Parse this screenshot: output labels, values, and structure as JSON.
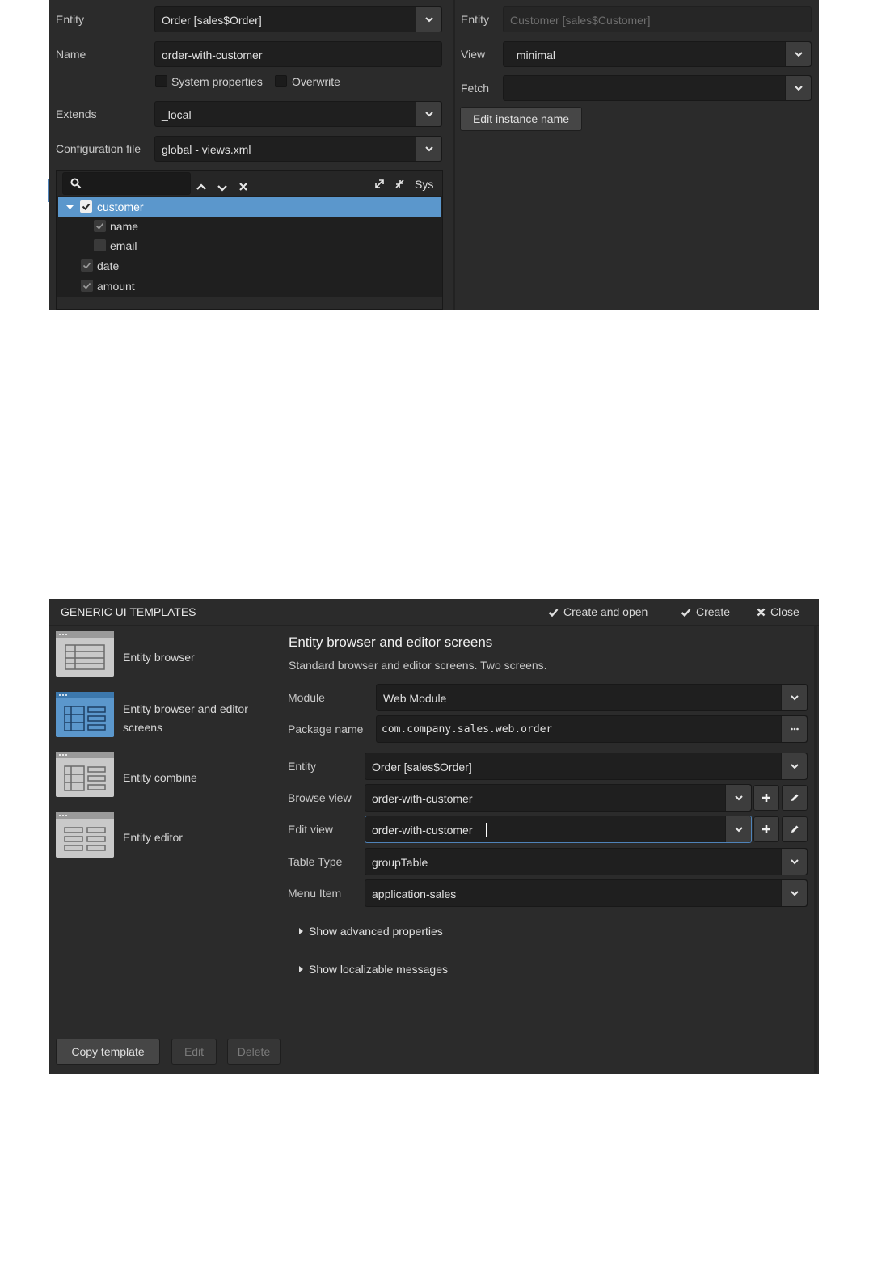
{
  "view_editor": {
    "left": {
      "entity_label": "Entity",
      "entity_value": "Order [sales$Order]",
      "name_label": "Name",
      "name_value": "order-with-customer",
      "system_properties_label": "System properties",
      "overwrite_label": "Overwrite",
      "extends_label": "Extends",
      "extends_value": "_local",
      "config_label": "Configuration file",
      "config_value": "global - views.xml",
      "sys_label": "Sys",
      "tree": [
        {
          "label": "customer",
          "checked": true,
          "selected": true
        },
        {
          "label": "name",
          "checked": true
        },
        {
          "label": "email",
          "checked": false
        },
        {
          "label": "date",
          "checked": true
        },
        {
          "label": "amount",
          "checked": true
        }
      ]
    },
    "right": {
      "entity_label": "Entity",
      "entity_value": "Customer [sales$Customer]",
      "view_label": "View",
      "view_value": "_minimal",
      "fetch_label": "Fetch",
      "fetch_value": "",
      "edit_instance_name": "Edit instance name"
    }
  },
  "templates_dialog": {
    "title": "GENERIC UI TEMPLATES",
    "actions": {
      "create_and_open": "Create and open",
      "create": "Create",
      "close": "Close"
    },
    "templates": [
      {
        "label": "Entity browser",
        "selected": false
      },
      {
        "label": "Entity browser and editor screens",
        "selected": true
      },
      {
        "label": "Entity combine",
        "selected": false
      },
      {
        "label": "Entity editor",
        "selected": false
      }
    ],
    "buttons": {
      "copy_template": "Copy template",
      "edit": "Edit",
      "delete": "Delete"
    },
    "detail": {
      "heading": "Entity browser and editor screens",
      "description": "Standard browser and editor screens. Two screens.",
      "module_label": "Module",
      "module_value": "Web Module",
      "package_label": "Package name",
      "package_value": "com.company.sales.web.order",
      "entity_label": "Entity",
      "entity_value": "Order [sales$Order]",
      "browse_view_label": "Browse view",
      "browse_view_value": "order-with-customer",
      "edit_view_label": "Edit view",
      "edit_view_value": "order-with-customer",
      "table_type_label": "Table Type",
      "table_type_value": "groupTable",
      "menu_item_label": "Menu Item",
      "menu_item_value": "application-sales",
      "show_advanced": "Show advanced properties",
      "show_localizable": "Show localizable messages"
    }
  },
  "colors": {
    "panel_bg": "#2b2b2b",
    "field_bg": "#1f1f1f",
    "selection": "#5b97cc",
    "focus_border": "#4f83b9"
  }
}
